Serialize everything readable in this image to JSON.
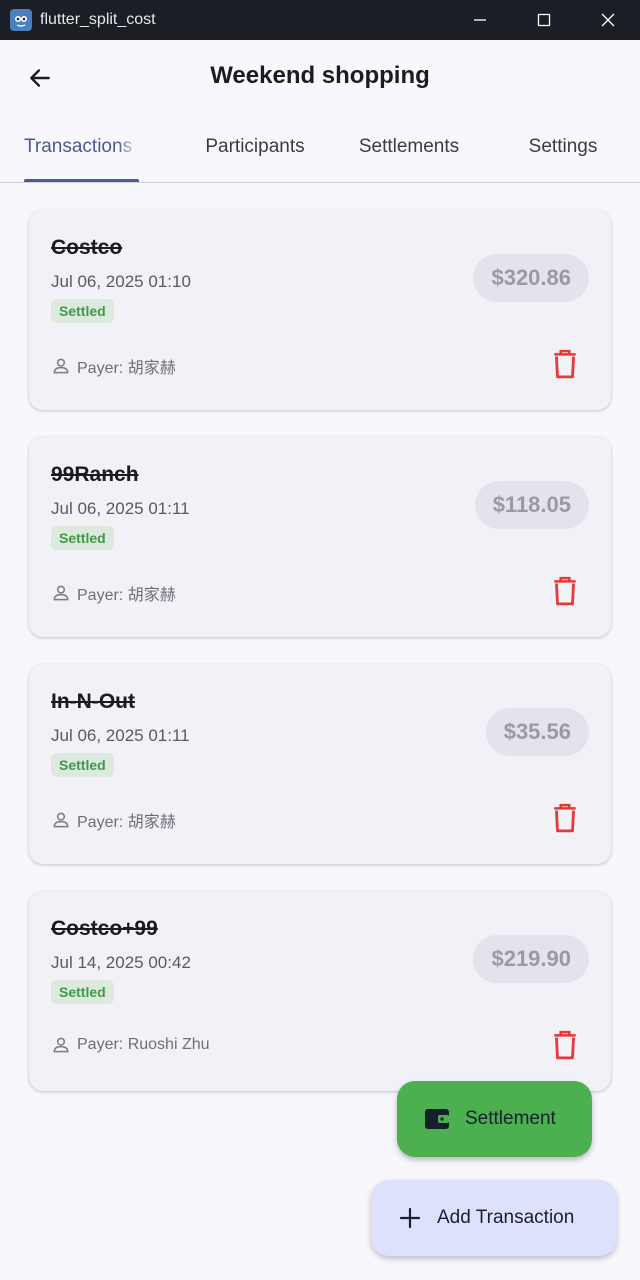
{
  "window": {
    "title": "flutter_split_cost"
  },
  "appbar": {
    "title": "Weekend shopping"
  },
  "tabs": [
    {
      "label": "Transactions"
    },
    {
      "label": "Participants"
    },
    {
      "label": "Settlements"
    },
    {
      "label": "Settings"
    }
  ],
  "transactions": [
    {
      "name": "Costco",
      "date": "Jul 06, 2025 01:10",
      "status": "Settled",
      "amount": "$320.86",
      "payer": "Payer: 胡家赫"
    },
    {
      "name": "99Ranch",
      "date": "Jul 06, 2025 01:11",
      "status": "Settled",
      "amount": "$118.05",
      "payer": "Payer: 胡家赫"
    },
    {
      "name": "In-N-Out",
      "date": "Jul 06, 2025 01:11",
      "status": "Settled",
      "amount": "$35.56",
      "payer": "Payer: 胡家赫"
    },
    {
      "name": "Costco+99",
      "date": "Jul 14, 2025 00:42",
      "status": "Settled",
      "amount": "$219.90",
      "payer": "Payer: Ruoshi Zhu"
    }
  ],
  "fabs": {
    "settlement_label": "Settlement",
    "add_label": "Add Transaction"
  },
  "colors": {
    "accent": "#4c5b8f",
    "settled": "#3d9a47",
    "delete": "#e53935",
    "settlement_fab": "#4caf50",
    "add_fab": "#dee1fb"
  }
}
